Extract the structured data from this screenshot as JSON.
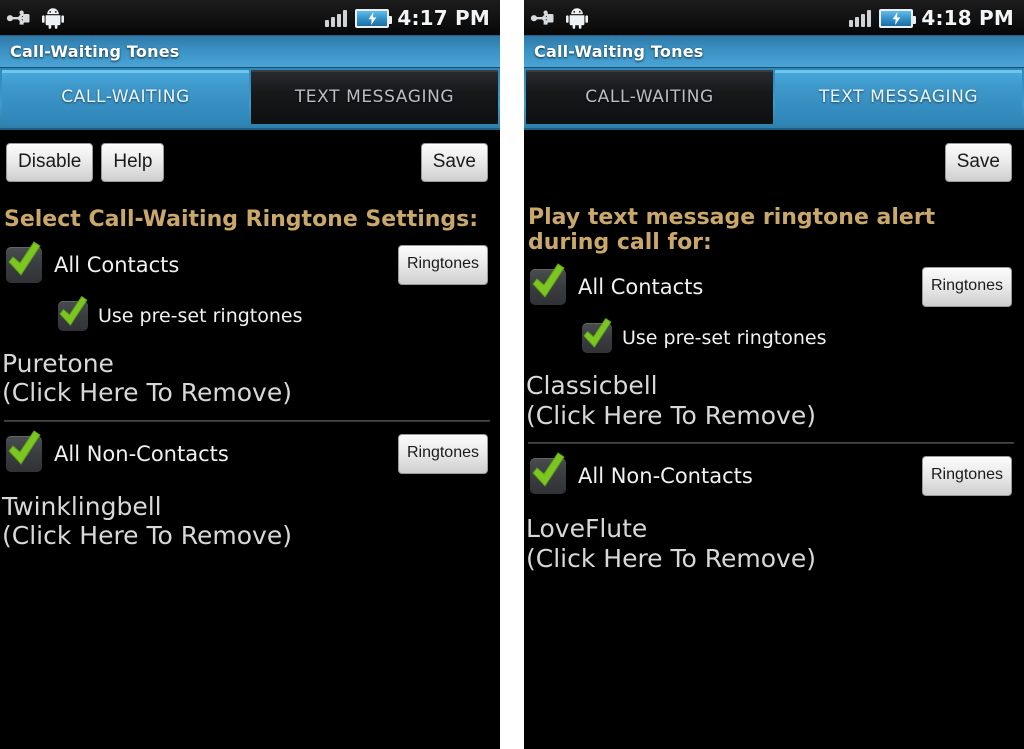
{
  "panels": [
    {
      "status": {
        "icons": [
          "usb-icon",
          "android-robot-icon",
          "signal-bars-icon",
          "battery-charging-icon"
        ],
        "time": "4:17 PM"
      },
      "title": "Call-Waiting Tones",
      "tabs": [
        {
          "label": "CALL-WAITING",
          "active": true
        },
        {
          "label": "TEXT MESSAGING",
          "active": false
        }
      ],
      "toolbar": {
        "left_buttons": [
          "Disable",
          "Help"
        ],
        "right_button": "Save"
      },
      "heading": "Select Call-Waiting Ringtone Settings:",
      "sections": [
        {
          "checkbox_label": "All Contacts",
          "checkbox_checked": true,
          "ringtones_button": "Ringtones",
          "preset_label": "Use pre-set ringtones",
          "preset_checked": true,
          "tone_name": "Puretone",
          "tone_hint": "(Click Here To Remove)",
          "divider_after": true
        },
        {
          "checkbox_label": "All Non-Contacts",
          "checkbox_checked": true,
          "ringtones_button": "Ringtones",
          "tone_name": "Twinklingbell",
          "tone_hint": "(Click Here To Remove)",
          "divider_after": false
        }
      ]
    },
    {
      "status": {
        "icons": [
          "usb-icon",
          "android-robot-icon",
          "signal-bars-icon",
          "battery-charging-icon"
        ],
        "time": "4:18 PM"
      },
      "title": "Call-Waiting Tones",
      "tabs": [
        {
          "label": "CALL-WAITING",
          "active": false
        },
        {
          "label": "TEXT MESSAGING",
          "active": true
        }
      ],
      "toolbar": {
        "left_buttons": [],
        "right_button": "Save"
      },
      "heading": "Play text message ringtone alert during call for:",
      "sections": [
        {
          "checkbox_label": "All Contacts",
          "checkbox_checked": true,
          "ringtones_button": "Ringtones",
          "preset_label": "Use pre-set ringtones",
          "preset_checked": true,
          "tone_name": "Classicbell",
          "tone_hint": "(Click Here To Remove)",
          "divider_after": true
        },
        {
          "checkbox_label": "All Non-Contacts",
          "checkbox_checked": true,
          "ringtones_button": "Ringtones",
          "tone_name": "LoveFlute",
          "tone_hint": "(Click Here To Remove)",
          "divider_after": false
        }
      ]
    }
  ],
  "colors": {
    "title_bar_blue": "#3b92c4",
    "tab_active_blue": "#3e97c9",
    "heading_gold": "#c9a86a",
    "checkmark_green": "#7cc621",
    "screen_background": "#000000",
    "button_face": "#ebebeb",
    "gap_background": "#ffffff"
  }
}
